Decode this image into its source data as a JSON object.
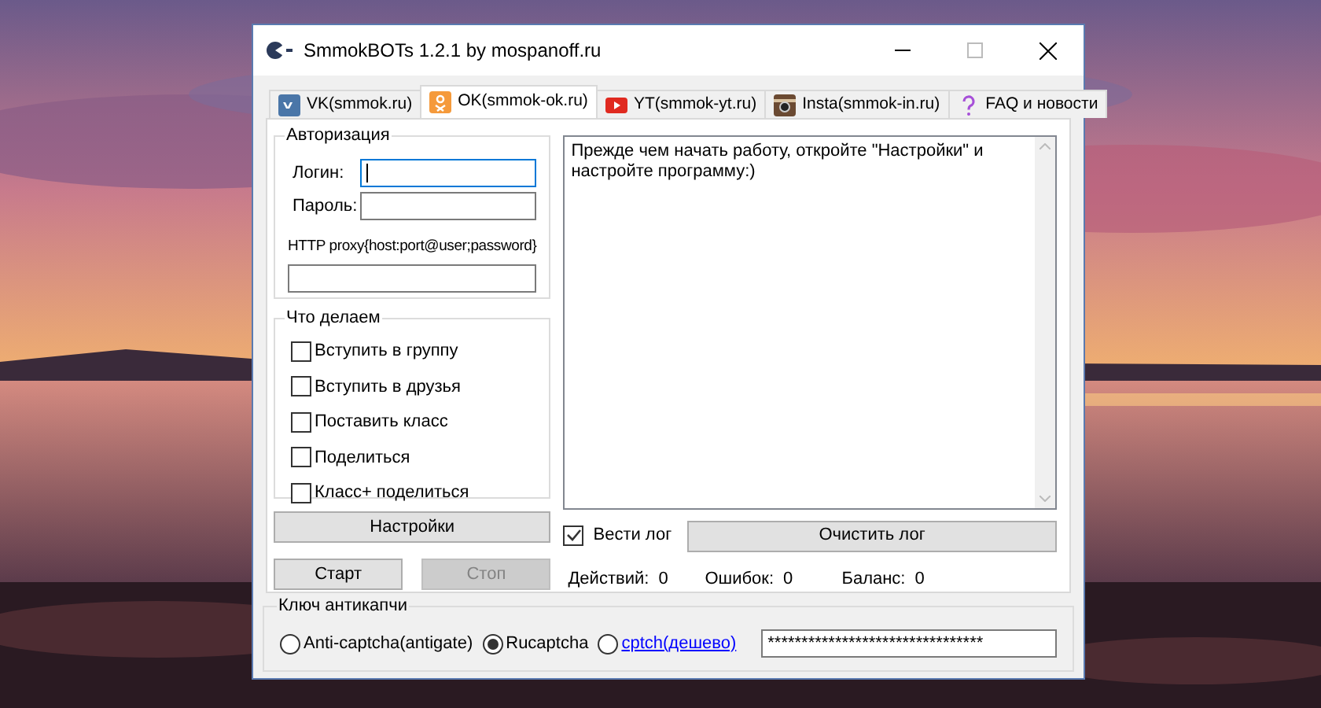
{
  "window": {
    "title": "SmmokBOTs 1.2.1 by mospanoff.ru"
  },
  "tabs": [
    {
      "label": "VK(smmok.ru)",
      "selected": false,
      "kind": "vk"
    },
    {
      "label": "OK(smmok-ok.ru)",
      "selected": true,
      "kind": "ok"
    },
    {
      "label": "YT(smmok-yt.ru)",
      "selected": false,
      "kind": "yt"
    },
    {
      "label": "Insta(smmok-in.ru)",
      "selected": false,
      "kind": "insta"
    },
    {
      "label": "FAQ и новости",
      "selected": false,
      "kind": "faq"
    }
  ],
  "auth": {
    "title": "Авторизация",
    "login_label": "Логин:",
    "login_focused": true,
    "password_label": "Пароль:",
    "proxy_label": "HTTP proxy{host:port@user;password}"
  },
  "actions": {
    "title": "Что делаем",
    "items": [
      {
        "label": "Вступить в группу",
        "checked": false
      },
      {
        "label": "Вступить в друзья",
        "checked": false
      },
      {
        "label": "Поставить класс",
        "checked": false
      },
      {
        "label": "Поделиться",
        "checked": false
      },
      {
        "label": "Класс+ поделиться",
        "checked": false
      }
    ]
  },
  "buttons": [
    {
      "label": "Настройки",
      "disabled": false
    },
    {
      "label": "Старт",
      "disabled": false
    },
    {
      "label": "Стоп",
      "disabled": true
    }
  ],
  "log": {
    "text": "Прежде чем начать работу, откройте \"Настройки\" и настройте программу:)",
    "keep_label": "Вести лог",
    "keep_checked": true,
    "clear_label": "Очистить лог"
  },
  "stats": [
    {
      "label": "Действий:",
      "value": "0"
    },
    {
      "label": "Ошибок:",
      "value": "0"
    },
    {
      "label": "Баланс:",
      "value": "0"
    }
  ],
  "captcha": {
    "title": "Ключ антикапчи",
    "options": [
      {
        "label": "Anti-captcha(antigate)",
        "selected": false,
        "kind": "text"
      },
      {
        "label": "Rucaptcha",
        "selected": true,
        "kind": "text"
      },
      {
        "label": "cptch(дешево)",
        "selected": false,
        "kind": "link"
      }
    ],
    "key": "********************************"
  }
}
